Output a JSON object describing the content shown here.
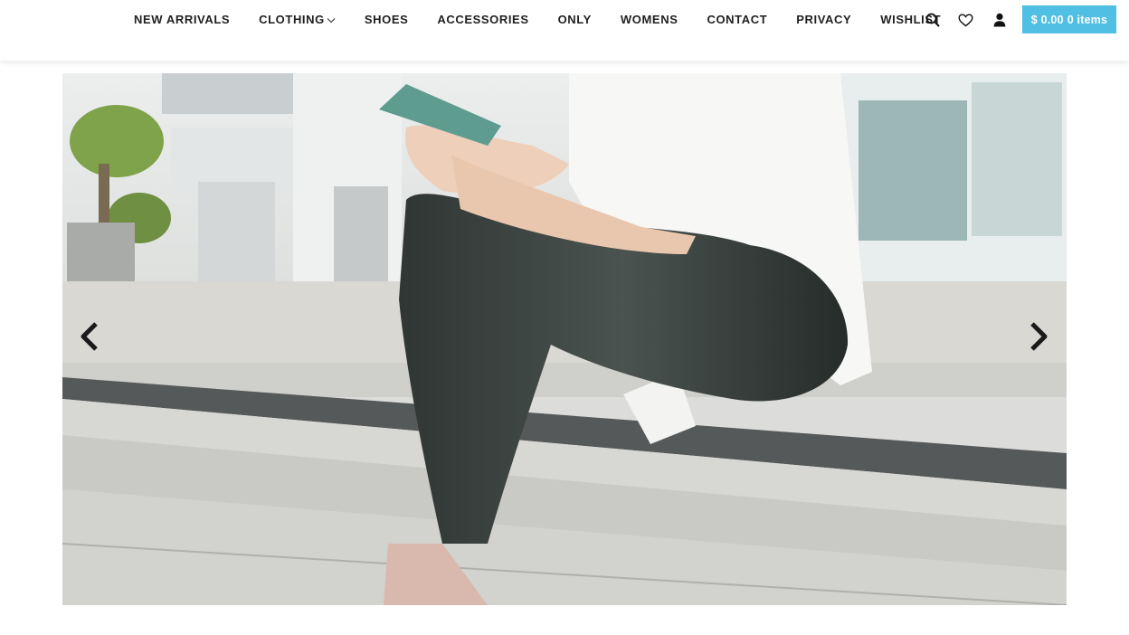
{
  "nav": {
    "items": [
      {
        "label": "NEW ARRIVALS"
      },
      {
        "label": "CLOTHING"
      },
      {
        "label": "SHOES"
      },
      {
        "label": "ACCESSORIES"
      },
      {
        "label": "ONLY"
      },
      {
        "label": "WOMENS"
      },
      {
        "label": "CONTACT"
      },
      {
        "label": "PRIVACY"
      },
      {
        "label": "WISHLIST"
      }
    ]
  },
  "header_icons": [
    "search-icon",
    "heart-icon",
    "user-icon"
  ],
  "cart": {
    "amount": "$ 0.00",
    "count": "0 items",
    "color": "#4fbfe3"
  },
  "slider": {
    "image": "woman-sitting-on-steps-photo",
    "prev_icon": "chevron-left-icon",
    "next_icon": "chevron-right-icon"
  }
}
